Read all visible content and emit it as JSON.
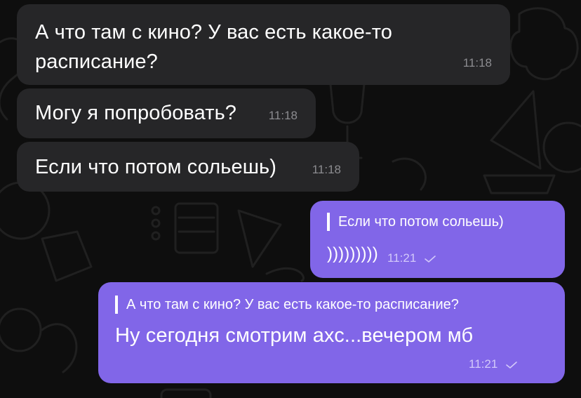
{
  "messages": [
    {
      "direction": "incoming",
      "lines": [
        "А что там с кино? У вас есть какое-то",
        "расписание?"
      ],
      "time": "11:18"
    },
    {
      "direction": "incoming",
      "text": "Могу я попробовать?",
      "time": "11:18"
    },
    {
      "direction": "incoming",
      "text": "Если что потом сольешь)",
      "time": "11:18"
    },
    {
      "direction": "outgoing",
      "reply_to": "Если что потом сольешь)",
      "text": ")))))))))",
      "time": "11:21",
      "status": "sent-check"
    },
    {
      "direction": "outgoing",
      "reply_to": "А что там с кино? У вас есть какое-то расписание?",
      "text": "Ну сегодня смотрим ахс...вечером мб",
      "time": "11:21",
      "status": "sent-check"
    }
  ],
  "colors": {
    "background": "#0e0e0e",
    "incoming_bubble": "#262628",
    "outgoing_bubble": "#8166e8",
    "incoming_time": "#8c8c90",
    "outgoing_time": "#d3c9fa"
  }
}
